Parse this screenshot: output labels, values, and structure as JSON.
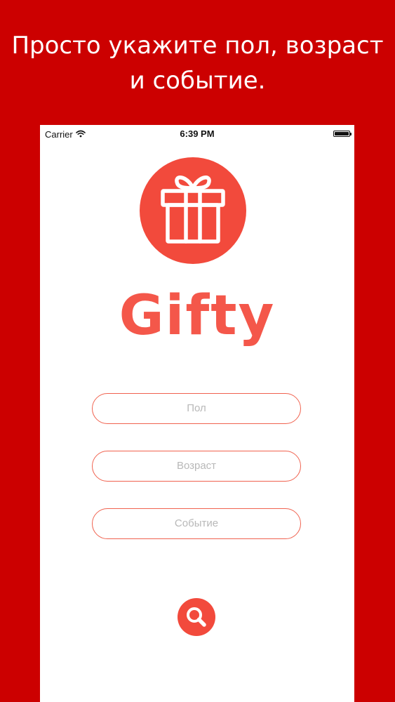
{
  "promo": {
    "line1": "Просто укажите пол, возраст",
    "line2": "и событие."
  },
  "statusbar": {
    "carrier": "Carrier",
    "time": "6:39 PM"
  },
  "app": {
    "name": "Gifty"
  },
  "form": {
    "gender_placeholder": "Пол",
    "age_placeholder": "Возраст",
    "event_placeholder": "Событие"
  },
  "icons": {
    "logo": "gift-icon",
    "wifi": "wifi-icon",
    "battery": "battery-icon",
    "search": "search-icon"
  },
  "colors": {
    "background": "#cc0000",
    "accent": "#f24a3c",
    "field_border": "#f0624f",
    "placeholder": "#b8b8b8"
  }
}
